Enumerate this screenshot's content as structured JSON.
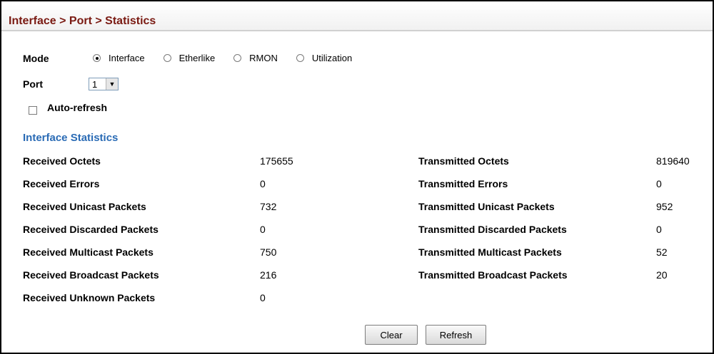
{
  "header": {
    "breadcrumb": "Interface > Port > Statistics"
  },
  "mode": {
    "label": "Mode",
    "options": [
      {
        "label": "Interface",
        "checked": true
      },
      {
        "label": "Etherlike",
        "checked": false
      },
      {
        "label": "RMON",
        "checked": false
      },
      {
        "label": "Utilization",
        "checked": false
      }
    ]
  },
  "port": {
    "label": "Port",
    "value": "1"
  },
  "auto_refresh": {
    "label": "Auto-refresh",
    "checked": false
  },
  "stats": {
    "title": "Interface Statistics",
    "received": [
      {
        "label": "Received Octets",
        "value": "175655"
      },
      {
        "label": "Received Errors",
        "value": "0"
      },
      {
        "label": "Received Unicast Packets",
        "value": "732"
      },
      {
        "label": "Received Discarded Packets",
        "value": "0"
      },
      {
        "label": "Received Multicast Packets",
        "value": "750"
      },
      {
        "label": "Received Broadcast Packets",
        "value": "216"
      },
      {
        "label": "Received Unknown Packets",
        "value": "0"
      }
    ],
    "transmitted": [
      {
        "label": "Transmitted Octets",
        "value": "819640"
      },
      {
        "label": "Transmitted Errors",
        "value": "0"
      },
      {
        "label": "Transmitted Unicast Packets",
        "value": "952"
      },
      {
        "label": "Transmitted Discarded Packets",
        "value": "0"
      },
      {
        "label": "Transmitted Multicast Packets",
        "value": "52"
      },
      {
        "label": "Transmitted Broadcast Packets",
        "value": "20"
      }
    ]
  },
  "buttons": {
    "clear": "Clear",
    "refresh": "Refresh"
  },
  "colors": {
    "title": "#7a1a12",
    "section": "#2a6bb5"
  }
}
